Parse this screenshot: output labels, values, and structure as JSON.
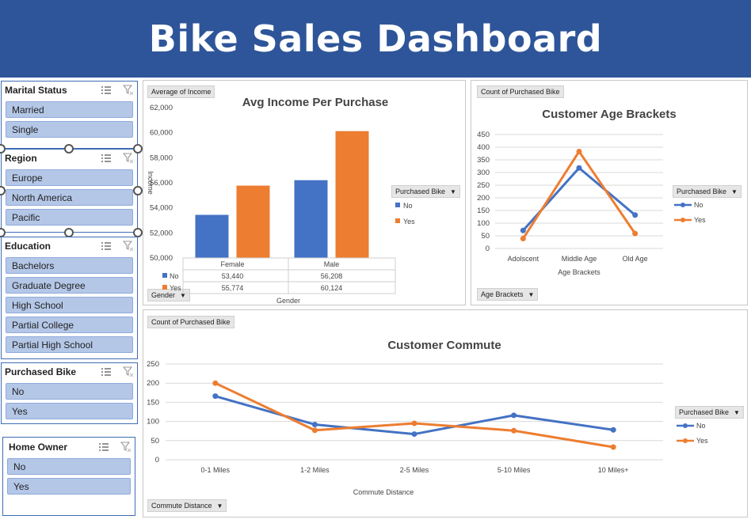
{
  "title": "Bike Sales Dashboard",
  "colors": {
    "banner": "#2e5599",
    "no": "#4472c4",
    "yes": "#ed7d31",
    "slicer_item": "#b4c7e7"
  },
  "slicers": {
    "marital": {
      "title": "Marital Status",
      "items": [
        "Married",
        "Single"
      ]
    },
    "region": {
      "title": "Region",
      "items": [
        "Europe",
        "North America",
        "Pacific"
      ]
    },
    "education": {
      "title": "Education",
      "items": [
        "Bachelors",
        "Graduate Degree",
        "High School",
        "Partial College",
        "Partial High School"
      ]
    },
    "purchased": {
      "title": "Purchased Bike",
      "items": [
        "No",
        "Yes"
      ]
    },
    "homeowner": {
      "title": "Home Owner",
      "items": [
        "No",
        "Yes"
      ]
    }
  },
  "income_chart": {
    "value_field": "Average of Income",
    "axis_field": "Gender",
    "legend_field": "Purchased Bike",
    "ylabel": "Income",
    "table_rows": [
      {
        "label": "No",
        "values": [
          "53,440",
          "56,208"
        ]
      },
      {
        "label": "Yes",
        "values": [
          "55,774",
          "60,124"
        ]
      }
    ]
  },
  "age_chart": {
    "value_field": "Count of Purchased Bike",
    "axis_field": "Age Brackets",
    "legend_field": "Purchased Bike"
  },
  "commute_chart": {
    "value_field": "Count of Purchased Bike",
    "axis_field": "Commute Distance",
    "legend_field": "Purchased Bike"
  },
  "chart_data": [
    {
      "type": "bar",
      "title": "Avg Income Per Purchase",
      "categories": [
        "Female",
        "Male"
      ],
      "xlabel": "Gender",
      "ylabel": "Income",
      "ylim": [
        50000,
        62000
      ],
      "yticks": [
        "50,000",
        "52,000",
        "54,000",
        "56,000",
        "58,000",
        "60,000",
        "62,000"
      ],
      "series": [
        {
          "name": "No",
          "values": [
            53440,
            56208
          ]
        },
        {
          "name": "Yes",
          "values": [
            55774,
            60124
          ]
        }
      ],
      "legend": "right",
      "grid": false
    },
    {
      "type": "line",
      "title": "Customer Age Brackets",
      "categories": [
        "Adolscent",
        "Middle Age",
        "Old Age"
      ],
      "xlabel": "Age Brackets",
      "ylabel": "",
      "ylim": [
        0,
        450
      ],
      "yticks": [
        "0",
        "50",
        "100",
        "150",
        "200",
        "250",
        "300",
        "350",
        "400",
        "450"
      ],
      "series": [
        {
          "name": "No",
          "values": [
            71,
            318,
            132
          ]
        },
        {
          "name": "Yes",
          "values": [
            39,
            383,
            59
          ]
        }
      ],
      "legend": "right",
      "grid": true
    },
    {
      "type": "line",
      "title": "Customer Commute",
      "categories": [
        "0-1 Miles",
        "1-2 Miles",
        "2-5 Miles",
        "5-10 Miles",
        "10 Miles+"
      ],
      "xlabel": "Commute Distance",
      "ylabel": "",
      "ylim": [
        0,
        250
      ],
      "yticks": [
        "0",
        "50",
        "100",
        "150",
        "200",
        "250"
      ],
      "series": [
        {
          "name": "No",
          "values": [
            166,
            92,
            67,
            116,
            78
          ]
        },
        {
          "name": "Yes",
          "values": [
            200,
            77,
            95,
            76,
            33
          ]
        }
      ],
      "legend": "right",
      "grid": true
    }
  ]
}
